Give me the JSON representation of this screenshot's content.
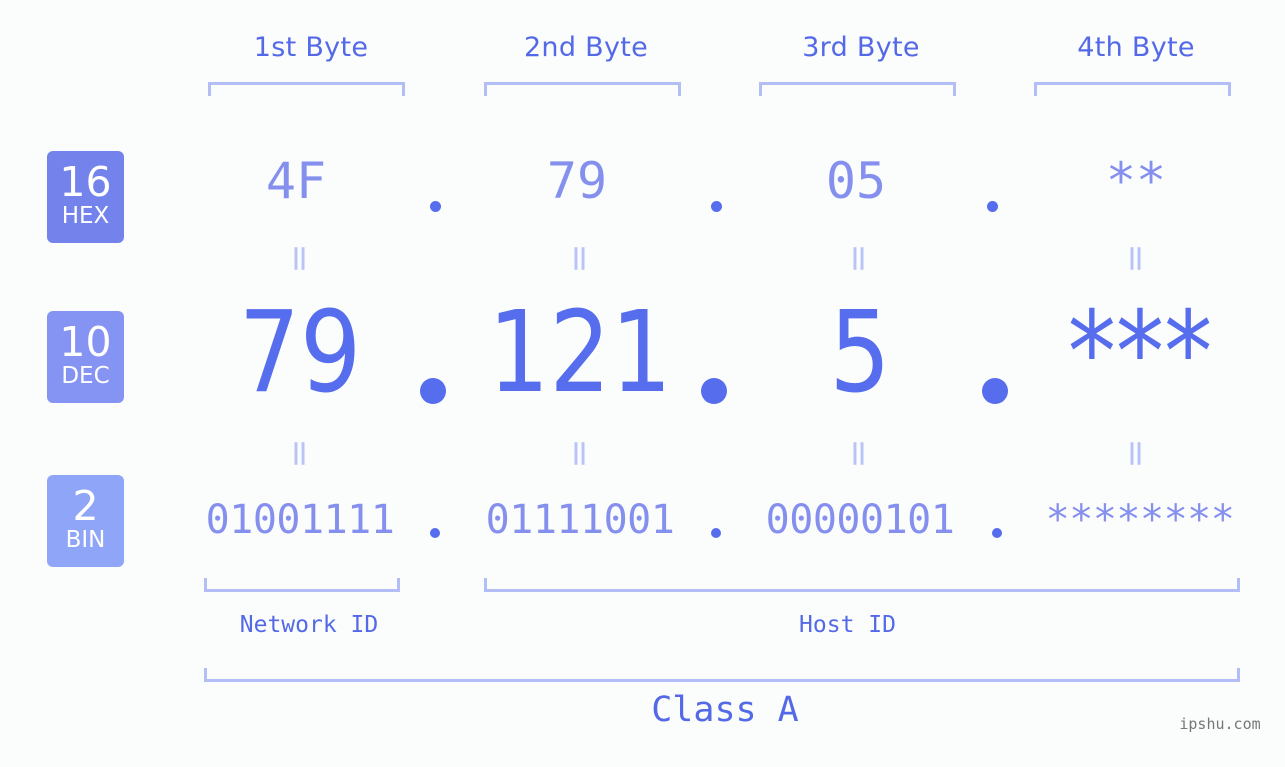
{
  "byte_headers": [
    "1st Byte",
    "2nd Byte",
    "3rd Byte",
    "4th Byte"
  ],
  "badges": {
    "hex": {
      "base": "16",
      "label": "HEX",
      "color": "#7483ec"
    },
    "dec": {
      "base": "10",
      "label": "DEC",
      "color": "#8594f2"
    },
    "bin": {
      "base": "2",
      "label": "BIN",
      "color": "#8fa6f8"
    }
  },
  "hex": [
    "4F",
    "79",
    "05",
    "**"
  ],
  "dec": [
    "79",
    "121",
    "5",
    "***"
  ],
  "bin": [
    "01001111",
    "01111001",
    "00000101",
    "********"
  ],
  "separator": ".",
  "equals": "=",
  "network_id_label": "Network ID",
  "host_id_label": "Host ID",
  "class_label": "Class A",
  "watermark": "ipshu.com",
  "colors": {
    "primary": "#566ded",
    "secondary": "#8590ee",
    "bracket": "#b3bdf6",
    "equals": "#b9c3f6"
  }
}
